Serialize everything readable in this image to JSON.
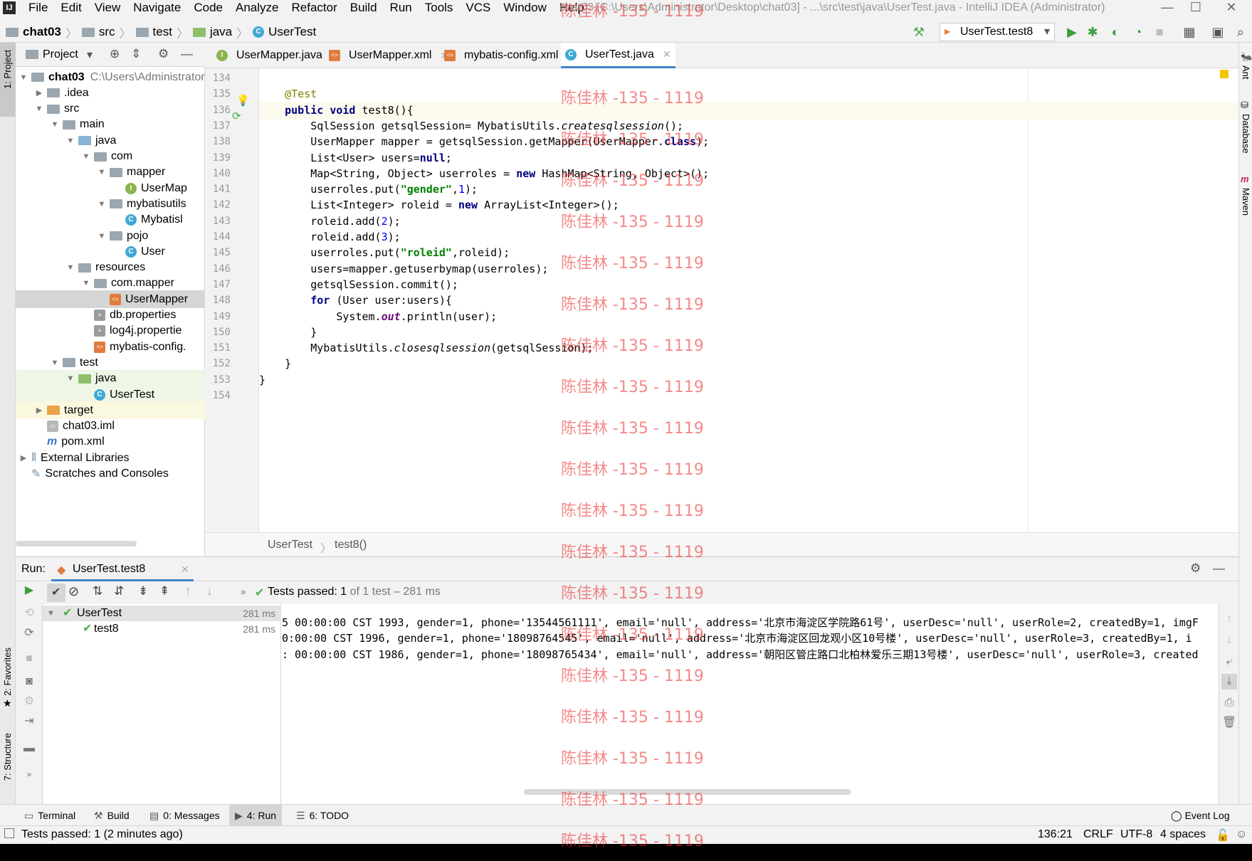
{
  "window": {
    "title": "chat03 [C:\\Users\\Administrator\\Desktop\\chat03] - ...\\src\\test\\java\\UserTest.java - IntelliJ IDEA (Administrator)",
    "menu": [
      "File",
      "Edit",
      "View",
      "Navigate",
      "Code",
      "Analyze",
      "Refactor",
      "Build",
      "Run",
      "Tools",
      "VCS",
      "Window",
      "Help"
    ]
  },
  "breadcrumb": [
    "chat03",
    "src",
    "test",
    "java",
    "UserTest"
  ],
  "run_config": "UserTest.test8",
  "left_strip": {
    "project": "1: Project",
    "favorites": "2: Favorites",
    "structure": "7: Structure"
  },
  "right_strip": {
    "ant": "Ant",
    "database": "Database",
    "maven": "Maven"
  },
  "project_panel": {
    "title": "Project",
    "tree": [
      {
        "label": "chat03",
        "extra": "C:\\Users\\Administrator",
        "depth": 0,
        "icon": "folder",
        "open": true,
        "bold": true
      },
      {
        "label": ".idea",
        "depth": 1,
        "icon": "folder",
        "open": false
      },
      {
        "label": "src",
        "depth": 1,
        "icon": "folder",
        "open": true
      },
      {
        "label": "main",
        "depth": 2,
        "icon": "folder",
        "open": true
      },
      {
        "label": "java",
        "depth": 3,
        "icon": "folder-blue",
        "open": true
      },
      {
        "label": "com",
        "depth": 4,
        "icon": "folder",
        "open": true
      },
      {
        "label": "mapper",
        "depth": 5,
        "icon": "folder",
        "open": true
      },
      {
        "label": "UserMap",
        "depth": 6,
        "icon": "interface"
      },
      {
        "label": "mybatisutils",
        "depth": 5,
        "icon": "folder",
        "open": true
      },
      {
        "label": "Mybatisl",
        "depth": 6,
        "icon": "class"
      },
      {
        "label": "pojo",
        "depth": 5,
        "icon": "folder",
        "open": true
      },
      {
        "label": "User",
        "depth": 6,
        "icon": "class"
      },
      {
        "label": "resources",
        "depth": 3,
        "icon": "folder",
        "open": true
      },
      {
        "label": "com.mapper",
        "depth": 4,
        "icon": "folder",
        "open": true
      },
      {
        "label": "UserMapper",
        "depth": 5,
        "icon": "xml",
        "selected": true
      },
      {
        "label": "db.properties",
        "depth": 4,
        "icon": "props"
      },
      {
        "label": "log4j.propertie",
        "depth": 4,
        "icon": "props"
      },
      {
        "label": "mybatis-config.",
        "depth": 4,
        "icon": "xml"
      },
      {
        "label": "test",
        "depth": 2,
        "icon": "folder",
        "open": true
      },
      {
        "label": "java",
        "depth": 3,
        "icon": "folder-green",
        "open": true,
        "tint": "green"
      },
      {
        "label": "UserTest",
        "depth": 4,
        "icon": "class",
        "tint": "green"
      },
      {
        "label": "target",
        "depth": 1,
        "icon": "folder-orange",
        "open": false,
        "tint": "yellow"
      },
      {
        "label": "chat03.iml",
        "depth": 1,
        "icon": "iml"
      },
      {
        "label": "pom.xml",
        "depth": 1,
        "icon": "maven"
      },
      {
        "label": "External Libraries",
        "depth": 0,
        "icon": "libs",
        "open": false
      },
      {
        "label": "Scratches and Consoles",
        "depth": 0,
        "icon": "scratch"
      }
    ]
  },
  "editor_tabs": [
    {
      "label": "UserMapper.java",
      "icon": "interface"
    },
    {
      "label": "UserMapper.xml",
      "icon": "xml"
    },
    {
      "label": "mybatis-config.xml",
      "icon": "xml"
    },
    {
      "label": "UserTest.java",
      "icon": "class",
      "active": true
    }
  ],
  "code_lines": [
    {
      "n": "134",
      "html": ""
    },
    {
      "n": "135",
      "html": "    <span class='ann'>@Test</span>"
    },
    {
      "n": "136",
      "html": "    <span class='kw'>public void</span> test8(){",
      "hl": true
    },
    {
      "n": "137",
      "html": "        SqlSession getsqlSession= MybatisUtils.<span class='it'>createsqlsession</span>();"
    },
    {
      "n": "138",
      "html": "        UserMapper mapper = getsqlSession.getMapper(UserMapper.<span class='kw'>class</span>);"
    },
    {
      "n": "139",
      "html": "        List&lt;User&gt; users=<span class='kw'>null</span>;"
    },
    {
      "n": "140",
      "html": "        Map&lt;String, Object&gt; userroles = <span class='kw'>new</span> HashMap&lt;String, Object&gt;();"
    },
    {
      "n": "141",
      "html": "        userroles.put(<span class='str'>\"gender\"</span>,<span class='num'>1</span>);"
    },
    {
      "n": "142",
      "html": "        List&lt;Integer&gt; roleid = <span class='kw'>new</span> ArrayList&lt;Integer&gt;();"
    },
    {
      "n": "143",
      "html": "        roleid.add(<span class='num'>2</span>);"
    },
    {
      "n": "144",
      "html": "        roleid.add(<span class='num'>3</span>);"
    },
    {
      "n": "145",
      "html": "        userroles.put(<span class='str'>\"roleid\"</span>,roleid);"
    },
    {
      "n": "146",
      "html": "        users=mapper.getuserbymap(userroles);"
    },
    {
      "n": "147",
      "html": "        getsqlSession.commit();"
    },
    {
      "n": "148",
      "html": "        <span class='kw'>for</span> (User user:users){"
    },
    {
      "n": "149",
      "html": "            System.<span class='fld'>out</span>.println(user);"
    },
    {
      "n": "150",
      "html": "        }"
    },
    {
      "n": "151",
      "html": "        MybatisUtils.<span class='it'>closesqlsession</span>(getsqlSession);"
    },
    {
      "n": "152",
      "html": "    }"
    },
    {
      "n": "153",
      "html": "}"
    },
    {
      "n": "154",
      "html": ""
    }
  ],
  "editor_breadcrumb": [
    "UserTest",
    "test8()"
  ],
  "watermark": "陈佳林 -135 - 1119",
  "run_panel": {
    "label": "Run:",
    "tab": "UserTest.test8",
    "status_prefix": "Tests passed:",
    "status_count": "1",
    "status_suffix": "of 1 test – 281 ms",
    "tests": [
      {
        "name": "UserTest",
        "time": "281 ms",
        "depth": 0
      },
      {
        "name": "test8",
        "time": "281 ms",
        "depth": 1
      }
    ],
    "console_lines": [
      "5 00:00:00 CST 1993, gender=1, phone='13544561111', email='null', address='北京市海淀区学院路61号', userDesc='null', userRole=2, createdBy=1, imgF",
      "0:00:00 CST 1996, gender=1, phone='18098764545', email='null', address='北京市海淀区回龙观小区10号楼', userDesc='null', userRole=3, createdBy=1, i",
      ": 00:00:00 CST 1986, gender=1, phone='18098765434', email='null', address='朝阳区管庄路口北柏林爱乐三期13号楼', userDesc='null', userRole=3, created"
    ]
  },
  "bottom_tabs": [
    {
      "label": "Terminal"
    },
    {
      "label": "Build"
    },
    {
      "label": "0: Messages"
    },
    {
      "label": "4: Run",
      "active": true
    },
    {
      "label": "6: TODO"
    }
  ],
  "event_log": "Event Log",
  "status": {
    "message": "Tests passed: 1 (2 minutes ago)",
    "position": "136:21",
    "line_sep": "CRLF",
    "encoding": "UTF-8",
    "indent": "4 spaces"
  }
}
